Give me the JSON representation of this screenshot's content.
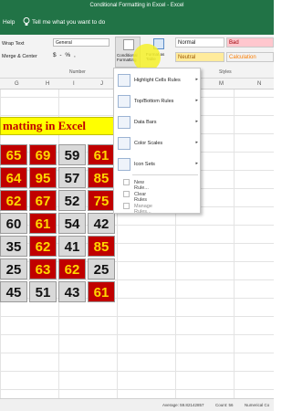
{
  "window": {
    "title": "Conditional Formatting in Excel  -  Excel",
    "help": "Help",
    "tell_me": "Tell me what you want to do"
  },
  "ribbon": {
    "wrap_text": "Wrap Text",
    "merge_center": "Merge & Center",
    "number_format": "General",
    "number_buttons": "$ - % ,",
    "group_number": "Number",
    "group_styles": "Styles",
    "conditional_formatting": "Conditional Formatting",
    "format_as_table": "Format as Table",
    "styles": {
      "normal": "Normal",
      "bad": "Bad",
      "neutral": "Neutral",
      "calculation": "Calculation"
    }
  },
  "columns": [
    "G",
    "H",
    "I",
    "J",
    "K",
    "L",
    "M",
    "N"
  ],
  "sheet": {
    "banner": "matting in Excel",
    "rows": [
      [
        {
          "v": "65",
          "s": "red"
        },
        {
          "v": "69",
          "s": "red"
        },
        {
          "v": "59",
          "s": "gray"
        },
        {
          "v": "61",
          "s": "red"
        }
      ],
      [
        {
          "v": "64",
          "s": "red"
        },
        {
          "v": "95",
          "s": "red"
        },
        {
          "v": "57",
          "s": "gray"
        },
        {
          "v": "85",
          "s": "red"
        }
      ],
      [
        {
          "v": "62",
          "s": "red"
        },
        {
          "v": "67",
          "s": "red"
        },
        {
          "v": "52",
          "s": "gray"
        },
        {
          "v": "75",
          "s": "red"
        }
      ],
      [
        {
          "v": "60",
          "s": "gray"
        },
        {
          "v": "61",
          "s": "red"
        },
        {
          "v": "54",
          "s": "gray"
        },
        {
          "v": "42",
          "s": "gray"
        }
      ],
      [
        {
          "v": "35",
          "s": "gray"
        },
        {
          "v": "62",
          "s": "red"
        },
        {
          "v": "41",
          "s": "gray"
        },
        {
          "v": "85",
          "s": "red"
        }
      ],
      [
        {
          "v": "25",
          "s": "gray"
        },
        {
          "v": "63",
          "s": "red"
        },
        {
          "v": "62",
          "s": "red"
        },
        {
          "v": "25",
          "s": "gray"
        }
      ],
      [
        {
          "v": "45",
          "s": "gray"
        },
        {
          "v": "51",
          "s": "gray"
        },
        {
          "v": "43",
          "s": "gray"
        },
        {
          "v": "61",
          "s": "red"
        }
      ]
    ]
  },
  "menu": {
    "items": [
      {
        "label": "Highlight Cells Rules",
        "icon": "highlight-cells-icon"
      },
      {
        "label": "Top/Bottom Rules",
        "icon": "top-bottom-icon"
      },
      {
        "label": "Data Bars",
        "icon": "data-bars-icon"
      },
      {
        "label": "Color Scales",
        "icon": "color-scales-icon"
      },
      {
        "label": "Icon Sets",
        "icon": "icon-sets-icon"
      }
    ],
    "new_rule": "New Rule...",
    "clear_rules": "Clear Rules",
    "manage_rules": "Manage Rules..."
  },
  "statusbar": {
    "average": "Average: 59.82142857",
    "count": "Count: 56",
    "numerical_count": "Numerical Co"
  },
  "colors": {
    "excel_green": "#217346",
    "red_fill": "#c00000",
    "yellow_text": "#ffd700",
    "gray_fill": "#d9d9d9",
    "banner_fill": "#ffff00"
  }
}
